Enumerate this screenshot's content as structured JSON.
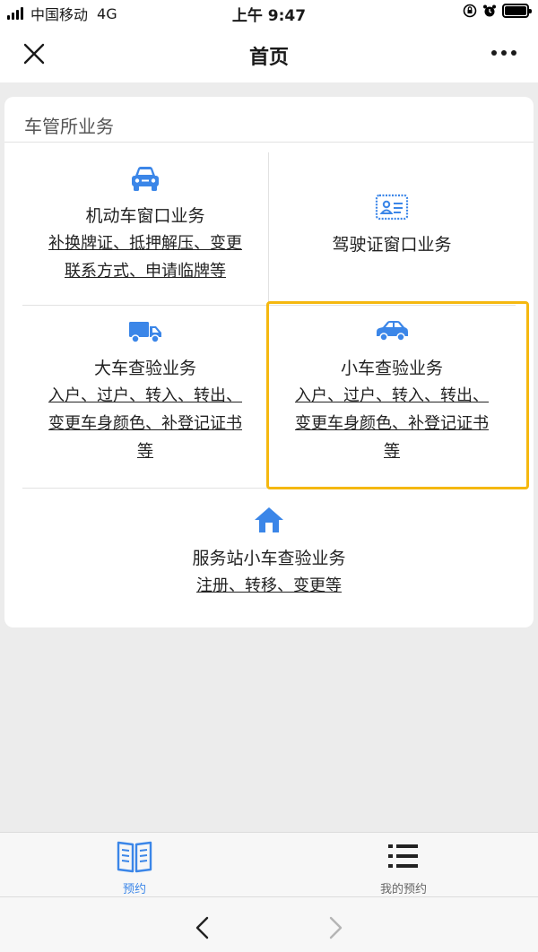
{
  "status_bar": {
    "carrier": "中国移动",
    "network": "4G",
    "time": "上午 9:47"
  },
  "nav": {
    "title": "首页"
  },
  "section": {
    "title": "车管所业务",
    "items": [
      {
        "icon": "car-front-icon",
        "title": "机动车窗口业务",
        "desc_lines": [
          "补换牌证、抵押解压、变更",
          "联系方式、申请临牌等"
        ]
      },
      {
        "icon": "license-card-icon",
        "title": "驾驶证窗口业务",
        "desc_lines": []
      },
      {
        "icon": "truck-icon",
        "title": "大车查验业务",
        "desc_lines": [
          "入户、过户、转入、转出、",
          "变更车身颜色、补登记证书",
          "等"
        ]
      },
      {
        "icon": "car-side-icon",
        "title": "小车查验业务",
        "desc_lines": [
          "入户、过户、转入、转出、",
          "变更车身颜色、补登记证书",
          "等"
        ]
      },
      {
        "icon": "house-icon",
        "title": "服务站小车查验业务",
        "desc_lines": [
          "注册、转移、变更等"
        ]
      }
    ]
  },
  "tabs": [
    {
      "label": "预约",
      "icon": "book-icon",
      "active": true
    },
    {
      "label": "我的预约",
      "icon": "list-icon",
      "active": false
    }
  ],
  "colors": {
    "accent": "#3b86e8",
    "highlight": "#f5b80f"
  }
}
